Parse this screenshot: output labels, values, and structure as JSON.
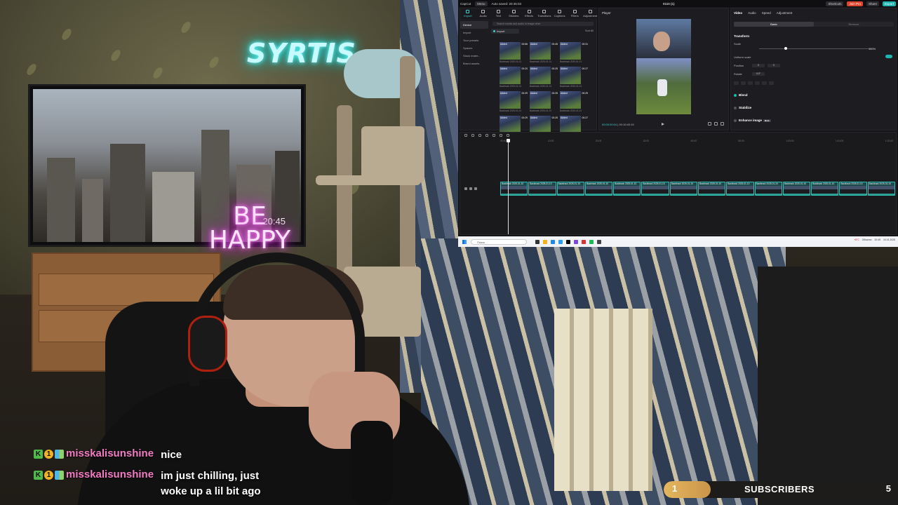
{
  "room": {
    "neon_sign_top": "SYRTIS",
    "neon_sign_bottom": "BE HAPPY",
    "tv_clock": "20:45"
  },
  "capcut": {
    "topbar": {
      "app_name": "CapCut",
      "menu_label": "Menu",
      "autosave": "Auto saved: 20:45:03",
      "title": "0110 (1)",
      "shortcuts": "Shortcuts",
      "join_pro": "Join Pro",
      "share": "Share",
      "export": "Export"
    },
    "tools": [
      {
        "label": "Import",
        "active": true
      },
      {
        "label": "Audio",
        "active": false
      },
      {
        "label": "Text",
        "active": false
      },
      {
        "label": "Stickers",
        "active": false
      },
      {
        "label": "Effects",
        "active": false
      },
      {
        "label": "Transitions",
        "active": false
      },
      {
        "label": "Captions",
        "active": false
      },
      {
        "label": "Filters",
        "active": false
      },
      {
        "label": "Adjustment",
        "active": false
      }
    ],
    "media_side": [
      "Device",
      "Import",
      "Your presets",
      "Spaces",
      "Stock mater...",
      "Brand assets"
    ],
    "media_search_placeholder": "Search media and audio in image drive",
    "import_label": "Import",
    "media_sort": "Sort  All",
    "media_items": [
      {
        "name": "Added",
        "dur": "00:56",
        "cap": "Backtrack 2025-01-01"
      },
      {
        "name": "Added",
        "dur": "00:45",
        "cap": "Backtrack 2025-01-01"
      },
      {
        "name": "Added",
        "dur": "00:31",
        "cap": "Backtrack 2025-01-01"
      },
      {
        "name": "Added",
        "dur": "00:20",
        "cap": "Backtrack 2025-01-01"
      },
      {
        "name": "Added",
        "dur": "00:25",
        "cap": "Backtrack 2025-01-01"
      },
      {
        "name": "Added",
        "dur": "00:27",
        "cap": "Backtrack 2025-01-01"
      },
      {
        "name": "Added",
        "dur": "00:29",
        "cap": "Backtrack 2025-01-01"
      },
      {
        "name": "Added",
        "dur": "00:25",
        "cap": "Backtrack 2025-01-01"
      },
      {
        "name": "Added",
        "dur": "00:29",
        "cap": "Backtrack 2025-01-01"
      },
      {
        "name": "Added",
        "dur": "00:29",
        "cap": "Backtrack 2025-01-01"
      },
      {
        "name": "Added",
        "dur": "00:25",
        "cap": "Backtrack 2025-01-01"
      },
      {
        "name": "Added",
        "dur": "00:27",
        "cap": "Backtrack 2025-01-01"
      }
    ],
    "player": {
      "label": "Player",
      "current_time": "00:00:00:04",
      "total_time": "00:10:40:19"
    },
    "props": {
      "tabs": [
        "Video",
        "Audio",
        "Speed",
        "Adjustment"
      ],
      "sub_tabs": [
        "Basic",
        "Remove"
      ],
      "transform": "Transform",
      "scale": "Scale",
      "scale_value": "100%",
      "uniform_scale": "Uniform scale",
      "position": "Position",
      "position_x": "0",
      "position_y": "0",
      "rotate": "Rotate",
      "rotate_value": "0.0°",
      "blend": "Blend",
      "stabilize": "Stabilize",
      "enhance_image": "Enhance image",
      "beta": "Beta"
    },
    "timeline": {
      "ruler": [
        "00:00",
        "10:00",
        "20:00",
        "30:00",
        "40:00",
        "50:00",
        "1:00:00",
        "1:10:00",
        "1:20:00"
      ],
      "clips": [
        "Backtrack 2025-01-10",
        "Backtrack 2025-01-10",
        "Backtrack 2025-01-10",
        "Backtrack 2025-01-10",
        "Backtrack 2025-01-10",
        "Backtrack 2025-01-10",
        "Backtrack 2025-01-10",
        "Backtrack 2025-01-10",
        "Backtrack 2025-01-10",
        "Backtrack 2025-01-10",
        "Backtrack 2025-01-10",
        "Backtrack 2025-01-10",
        "Backtrack 2025-01-10",
        "Backtrack 2025-01-10"
      ]
    },
    "taskbar": {
      "search_placeholder": "Поиск",
      "weather": "+8°C",
      "weather_desc": "Облачно",
      "time": "20:45",
      "date": "10.01.2025"
    }
  },
  "chat": [
    {
      "badges": [
        "K",
        "1",
        ""
      ],
      "user": "misskalisunshine",
      "text": "nice"
    },
    {
      "badges": [
        "K",
        "1",
        ""
      ],
      "user": "misskalisunshine",
      "text": "im just chilling, just woke up a lil bit ago"
    }
  ],
  "subscribers": {
    "current": "1",
    "label": "SUBSCRIBERS",
    "goal": "5",
    "progress_fraction": 0.2
  }
}
